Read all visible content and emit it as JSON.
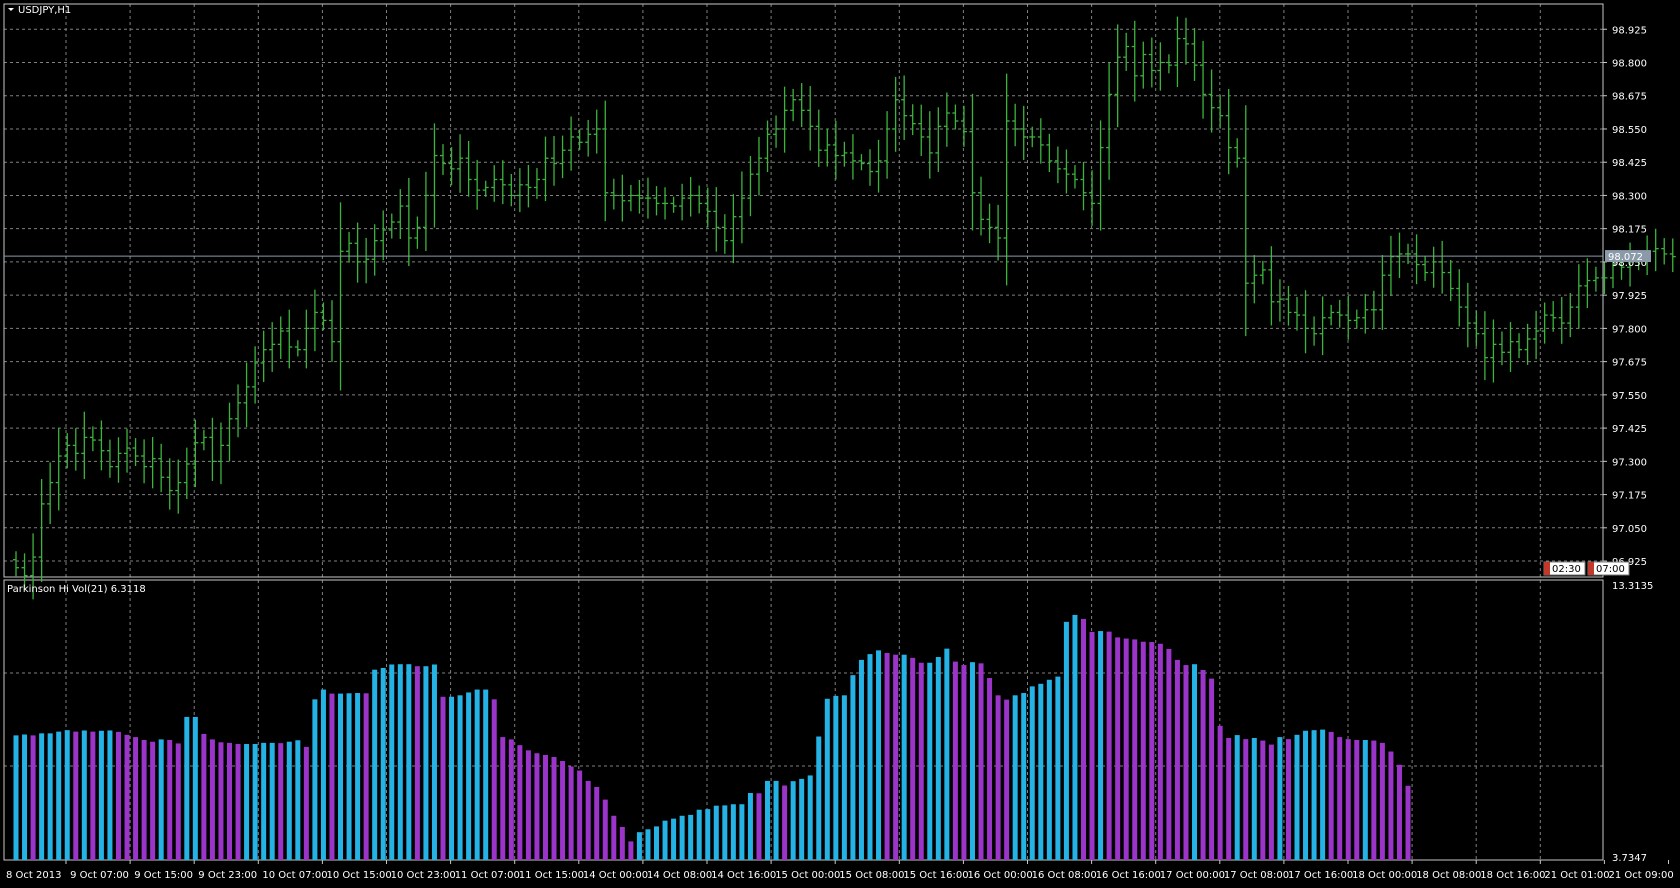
{
  "chart_window": {
    "symbol_title": "USDJPY,H1",
    "indicator_title": "Parkinson Hi Vol(21) 6.3118",
    "current_price_label": "98.072",
    "time_marker_1": "02:30",
    "time_marker_2": "07:00",
    "colors": {
      "background": "#000000",
      "grid": "#808080",
      "bars": "#3cb43c",
      "vol_up": "#25b3e6",
      "vol_down": "#9b34c8",
      "current_price_line": "#8a9aa8"
    }
  },
  "chart_data": [
    {
      "type": "bar",
      "subtype": "ohlc",
      "title": "USDJPY,H1",
      "ylim": [
        96.865,
        99.02
      ],
      "y_ticks": [
        "98.925",
        "98.800",
        "98.675",
        "98.550",
        "98.425",
        "98.300",
        "98.175",
        "98.050",
        "97.925",
        "97.800",
        "97.675",
        "97.550",
        "97.425",
        "97.300",
        "97.175",
        "97.050",
        "96.925"
      ],
      "grid": true,
      "x_ticks": [
        "8 Oct 2013",
        "9 Oct 07:00",
        "9 Oct 15:00",
        "9 Oct 23:00",
        "10 Oct 07:00",
        "10 Oct 15:00",
        "10 Oct 23:00",
        "11 Oct 07:00",
        "11 Oct 15:00",
        "14 Oct 00:00",
        "14 Oct 08:00",
        "14 Oct 16:00",
        "15 Oct 00:00",
        "15 Oct 08:00",
        "15 Oct 16:00",
        "16 Oct 00:00",
        "16 Oct 08:00",
        "16 Oct 16:00",
        "17 Oct 00:00",
        "17 Oct 08:00",
        "17 Oct 16:00",
        "18 Oct 00:00",
        "18 Oct 08:00",
        "18 Oct 16:00",
        "21 Oct 01:00",
        "21 Oct 09:00"
      ],
      "closes": [
        96.9,
        96.87,
        96.94,
        97.14,
        97.22,
        97.32,
        97.36,
        97.33,
        97.39,
        97.38,
        97.34,
        97.28,
        97.33,
        97.35,
        97.32,
        97.28,
        97.31,
        97.24,
        97.19,
        97.22,
        97.29,
        97.37,
        97.39,
        97.3,
        97.36,
        97.46,
        97.52,
        97.58,
        97.67,
        97.72,
        97.74,
        97.79,
        97.73,
        97.72,
        97.8,
        97.86,
        97.83,
        97.75,
        98.09,
        98.12,
        98.05,
        98.06,
        98.13,
        98.17,
        98.2,
        98.26,
        98.14,
        98.18,
        98.3,
        98.45,
        98.42,
        98.4,
        98.44,
        98.36,
        98.32,
        98.33,
        98.36,
        98.34,
        98.3,
        98.34,
        98.33,
        98.36,
        98.44,
        98.42,
        98.47,
        98.52,
        98.5,
        98.53,
        98.55,
        98.31,
        98.3,
        98.28,
        98.3,
        98.29,
        98.29,
        98.27,
        98.27,
        98.26,
        98.29,
        98.3,
        98.27,
        98.24,
        98.18,
        98.13,
        98.22,
        98.29,
        98.38,
        98.44,
        98.53,
        98.55,
        98.62,
        98.66,
        98.62,
        98.56,
        98.47,
        98.49,
        98.45,
        98.46,
        98.43,
        98.42,
        98.39,
        98.43,
        98.55,
        98.66,
        98.6,
        98.57,
        98.52,
        98.46,
        98.56,
        98.61,
        98.58,
        98.54,
        98.31,
        98.21,
        98.18,
        98.14,
        98.58,
        98.55,
        98.52,
        98.52,
        98.49,
        98.43,
        98.4,
        98.38,
        98.36,
        98.31,
        98.27,
        98.48,
        98.68,
        98.82,
        98.86,
        98.75,
        98.83,
        98.77,
        98.8,
        98.79,
        98.89,
        98.87,
        98.79,
        98.68,
        98.63,
        98.6,
        98.48,
        98.44,
        97.97,
        98.0,
        98.02,
        97.9,
        97.91,
        97.86,
        97.85,
        97.8,
        97.78,
        97.84,
        97.86,
        97.85,
        97.83,
        97.84,
        97.87,
        97.87,
        98.0,
        98.07,
        98.08,
        98.08,
        98.04,
        98.01,
        98.05,
        98.01,
        97.95,
        97.88,
        97.82,
        97.78,
        97.69,
        97.74,
        97.71,
        97.75,
        97.72,
        97.76,
        97.79,
        97.85,
        97.84,
        97.82,
        97.88,
        97.96,
        97.98,
        97.99,
        97.99,
        98.04,
        98.03,
        98.05,
        98.06,
        98.09,
        98.1,
        98.08,
        98.07
      ]
    },
    {
      "type": "bar",
      "title": "Parkinson Hi Vol(21) 6.3118",
      "ylim": [
        3.7347,
        13.3135
      ],
      "y_ticks": [
        "13.3135",
        "3.7347"
      ],
      "grid": true,
      "last_value": 6.3118,
      "values": [
        8.06,
        8.09,
        8.06,
        8.13,
        8.13,
        8.19,
        8.24,
        8.19,
        8.23,
        8.19,
        8.22,
        8.23,
        8.18,
        8.08,
        8.0,
        7.9,
        7.84,
        7.92,
        7.9,
        7.78,
        8.7,
        8.7,
        8.11,
        7.92,
        7.82,
        7.8,
        7.76,
        7.76,
        7.76,
        7.8,
        7.8,
        7.79,
        7.84,
        7.89,
        7.66,
        9.31,
        9.65,
        9.51,
        9.51,
        9.52,
        9.53,
        9.52,
        10.34,
        10.4,
        10.52,
        10.53,
        10.53,
        10.46,
        10.46,
        10.52,
        9.4,
        9.4,
        9.45,
        9.55,
        9.65,
        9.65,
        9.31,
        8.0,
        7.92,
        7.72,
        7.54,
        7.44,
        7.38,
        7.31,
        7.17,
        6.98,
        6.84,
        6.48,
        6.27,
        5.83,
        5.27,
        4.88,
        4.38,
        4.7,
        4.8,
        4.9,
        5.1,
        5.17,
        5.27,
        5.3,
        5.48,
        5.5,
        5.62,
        5.63,
        5.67,
        5.67,
        6.06,
        6.05,
        6.48,
        6.48,
        6.32,
        6.47,
        6.55,
        6.67,
        8.02,
        9.33,
        9.43,
        9.45,
        10.15,
        10.68,
        10.88,
        11.01,
        10.92,
        10.86,
        10.86,
        10.75,
        10.58,
        10.58,
        10.78,
        11.07,
        10.62,
        10.5,
        10.6,
        10.56,
        10.05,
        9.45,
        9.3,
        9.45,
        9.53,
        9.76,
        9.85,
        9.99,
        10.1,
        12.0,
        12.24,
        12.1,
        11.65,
        11.68,
        11.66,
        11.46,
        11.42,
        11.39,
        11.31,
        11.3,
        11.24,
        11.06,
        10.68,
        10.5,
        10.53,
        10.33,
        10.03,
        8.39,
        7.97,
        8.07,
        7.93,
        7.97,
        7.88,
        7.74,
        8.0,
        7.93,
        8.08,
        8.22,
        8.24,
        8.26,
        8.18,
        8.0,
        7.93,
        7.9,
        7.9,
        7.88,
        7.8,
        7.5,
        7.04,
        6.31
      ]
    }
  ]
}
